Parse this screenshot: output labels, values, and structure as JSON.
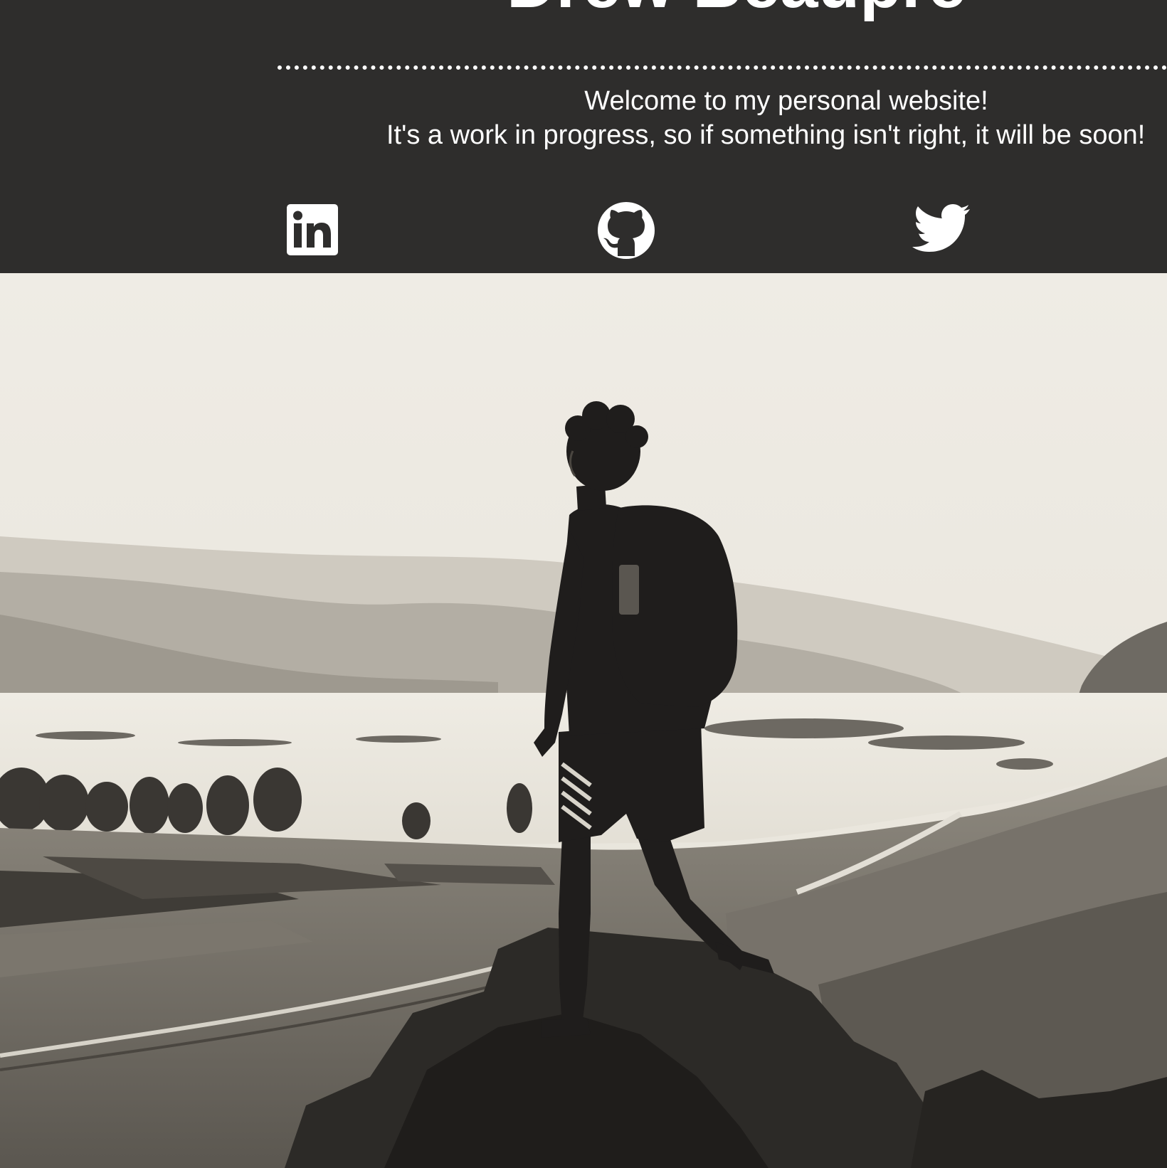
{
  "header": {
    "title": "Drew Beaupre",
    "welcome_line_1": "Welcome to my personal website!",
    "welcome_line_2": "It's a work in progress, so if something isn't right, it will be soon!",
    "background_color": "#2e2d2c",
    "text_color": "#ffffff"
  },
  "social_links": [
    {
      "name": "LinkedIn",
      "icon": "linkedin-icon"
    },
    {
      "name": "GitHub",
      "icon": "github-icon"
    },
    {
      "name": "Twitter",
      "icon": "twitter-icon"
    }
  ],
  "hero": {
    "icon": "hiker-photo",
    "palette": [
      "#eeebe4",
      "#1f1d1c",
      "#9c978d"
    ]
  }
}
